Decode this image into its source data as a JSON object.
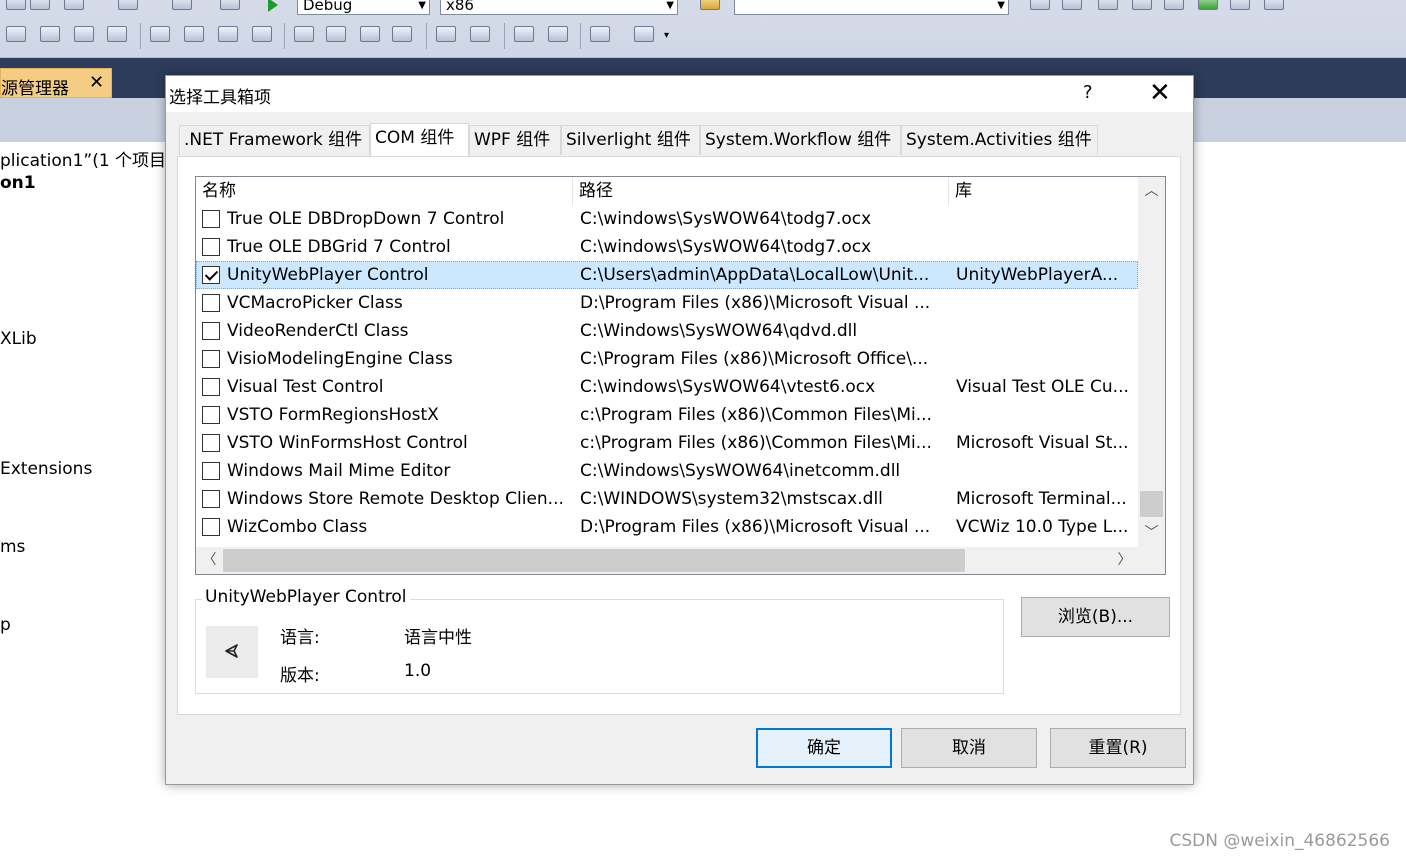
{
  "ide": {
    "toolbar": {
      "config_combo": "Debug",
      "platform_combo": "x86",
      "find_combo": ""
    },
    "panel_tab": {
      "label": "源管理器",
      "close": "✕"
    },
    "side_panel": {
      "lines": [
        "plication1”(1 个项目",
        "on1",
        "XLib",
        "Extensions",
        "ms",
        "p"
      ]
    }
  },
  "dialog": {
    "title": "选择工具箱项",
    "help": "?",
    "close": "✕",
    "tabs": [
      {
        "label": ".NET Framework 组件",
        "active": false
      },
      {
        "label": "COM 组件",
        "active": true
      },
      {
        "label": "WPF 组件",
        "active": false
      },
      {
        "label": "Silverlight 组件",
        "active": false
      },
      {
        "label": "System.Workflow 组件",
        "active": false
      },
      {
        "label": "System.Activities 组件",
        "active": false
      }
    ],
    "list": {
      "columns": [
        "名称",
        "路径",
        "库"
      ],
      "rows": [
        {
          "checked": false,
          "name": "True OLE DBDropDown 7 Control",
          "path": "C:\\windows\\SysWOW64\\todg7.ocx",
          "lib": ""
        },
        {
          "checked": false,
          "name": "True OLE DBGrid 7  Control",
          "path": "C:\\windows\\SysWOW64\\todg7.ocx",
          "lib": ""
        },
        {
          "checked": true,
          "name": "UnityWebPlayer Control",
          "path": "C:\\Users\\admin\\AppData\\LocalLow\\Unit...",
          "lib": "UnityWebPlayerA...",
          "selected": true
        },
        {
          "checked": false,
          "name": "VCMacroPicker Class",
          "path": "D:\\Program Files (x86)\\Microsoft Visual ...",
          "lib": ""
        },
        {
          "checked": false,
          "name": "VideoRenderCtl Class",
          "path": "C:\\Windows\\SysWOW64\\qdvd.dll",
          "lib": ""
        },
        {
          "checked": false,
          "name": "VisioModelingEngine Class",
          "path": "C:\\Program Files (x86)\\Microsoft Office\\...",
          "lib": ""
        },
        {
          "checked": false,
          "name": "Visual Test Control",
          "path": "C:\\windows\\SysWOW64\\vtest6.ocx",
          "lib": "Visual Test OLE Cu..."
        },
        {
          "checked": false,
          "name": "VSTO FormRegionsHostX",
          "path": "c:\\Program Files (x86)\\Common Files\\Mi...",
          "lib": ""
        },
        {
          "checked": false,
          "name": "VSTO WinFormsHost Control",
          "path": "c:\\Program Files (x86)\\Common Files\\Mi...",
          "lib": "Microsoft Visual St..."
        },
        {
          "checked": false,
          "name": "Windows Mail Mime Editor",
          "path": "C:\\Windows\\SysWOW64\\inetcomm.dll",
          "lib": ""
        },
        {
          "checked": false,
          "name": "Windows Store Remote Desktop Clien...",
          "path": "C:\\WINDOWS\\system32\\mstscax.dll",
          "lib": "Microsoft Terminal..."
        },
        {
          "checked": false,
          "name": "WizCombo Class",
          "path": "D:\\Program Files (x86)\\Microsoft Visual ...",
          "lib": "VCWiz 10.0 Type L..."
        }
      ]
    },
    "details": {
      "legend": "UnityWebPlayer Control",
      "language_label": "语言:",
      "language_value": "语言中性",
      "version_label": "版本:",
      "version_value": "1.0"
    },
    "buttons": {
      "browse": "浏览(B)...",
      "ok": "确定",
      "cancel": "取消",
      "reset": "重置(R)"
    }
  },
  "watermark": "CSDN @weixin_46862566",
  "colors": {
    "selection": "#cce8ff",
    "ide_dark": "#2d3c5a",
    "panel_tab": "#f5cc84",
    "default_button_border": "#0078d7"
  }
}
